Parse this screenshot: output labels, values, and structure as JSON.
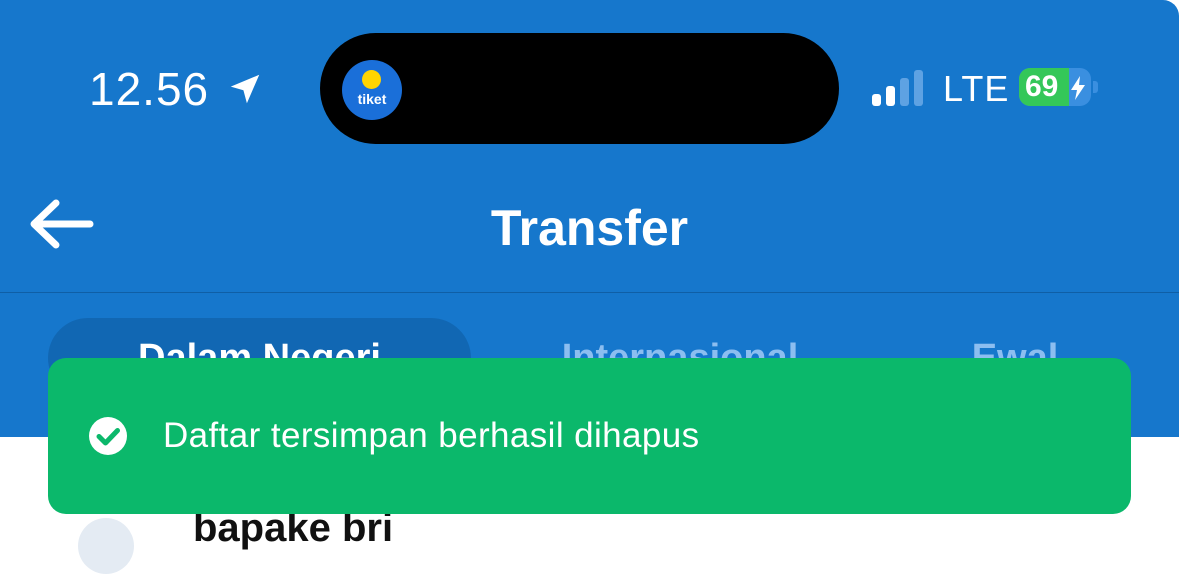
{
  "status_bar": {
    "time": "12.56",
    "network": "LTE",
    "battery_percent": "69",
    "battery_level": 0.69,
    "signal_bars_active": 2,
    "location_icon": "location-arrow-icon",
    "app_badge_text": "tiket"
  },
  "header": {
    "title": "Transfer",
    "back_icon": "arrow-left-icon",
    "background": "#1677cc"
  },
  "tabs": [
    {
      "label": "Dalam Negeri",
      "active": true
    },
    {
      "label": "Internasional",
      "active": false
    },
    {
      "label": "Ewal",
      "active": false
    }
  ],
  "toast": {
    "icon": "check-circle-icon",
    "message": "Daftar tersimpan berhasil dihapus",
    "background": "#0bb86b"
  },
  "list": {
    "items": [
      {
        "name": "bapake bri"
      }
    ]
  }
}
